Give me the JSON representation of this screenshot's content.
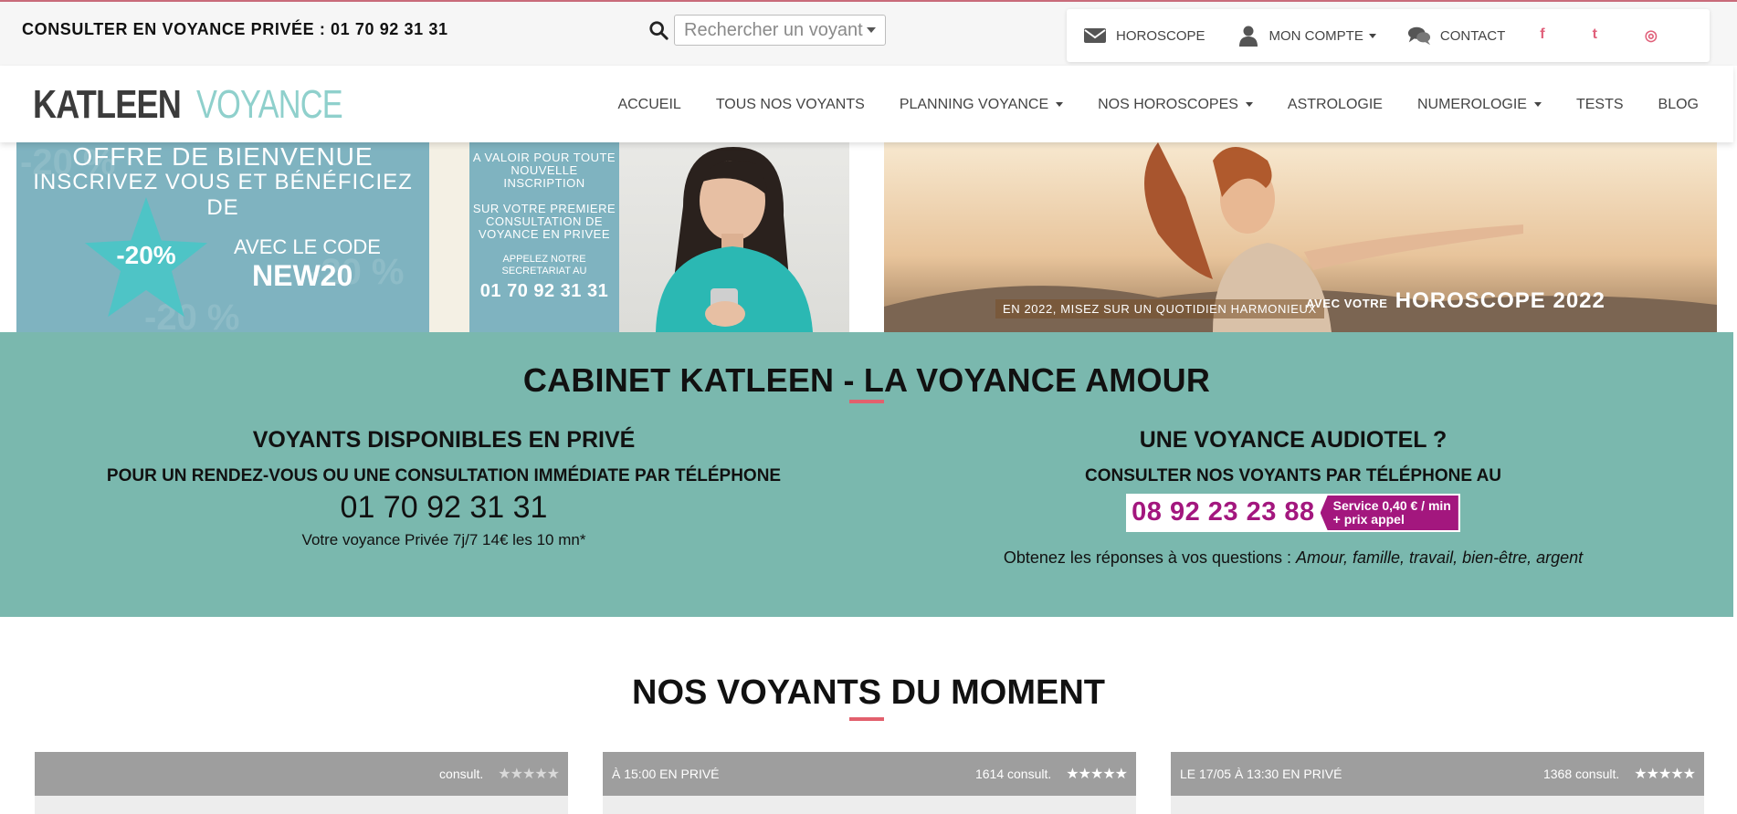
{
  "topbar": {
    "phone_line": "CONSULTER EN VOYANCE PRIVÉE : 01 70 92 31 31",
    "search_placeholder": "Rechercher un voyant",
    "menu": {
      "horoscope": "HOROSCOPE",
      "account": "MON COMPTE",
      "contact": "CONTACT"
    },
    "social": {
      "facebook": "f",
      "twitter": "t",
      "instagram": "◎"
    }
  },
  "navbar": {
    "logo_main": "KATLEEN",
    "logo_sub": "VOYANCE",
    "items": [
      "ACCUEIL",
      "TOUS NOS VOYANTS",
      "PLANNING VOYANCE",
      "NOS HOROSCOPES",
      "ASTROLOGIE",
      "NUMEROLOGIE",
      "TESTS",
      "BLOG"
    ]
  },
  "banner_left": {
    "title1": "OFFRE DE BIENVENUE",
    "title2": "INSCRIVEZ VOUS ET BÉNÉFICIEZ DE",
    "discount": "-20%",
    "code_label": "AVEC LE CODE",
    "code": "NEW20",
    "side1": "A VALOIR POUR TOUTE NOUVELLE INSCRIPTION",
    "side2": "SUR VOTRE PREMIERE CONSULTATION DE VOYANCE EN PRIVEE",
    "side3": "APPELEZ NOTRE SECRETARIAT AU",
    "side4": "01 70 92 31 31"
  },
  "banner_right": {
    "caption1": "EN 2022, MISEZ SUR UN QUOTIDIEN HARMONIEUX",
    "caption2_pre": "AVEC VOTRE",
    "caption2_big": "HOROSCOPE 2022"
  },
  "cabinet": {
    "title": "CABINET KATLEEN - LA VOYANCE AMOUR",
    "left": {
      "heading": "VOYANTS DISPONIBLES EN PRIVÉ",
      "sub": "POUR UN RENDEZ-VOUS OU UNE CONSULTATION IMMÉDIATE PAR TÉLÉPHONE",
      "phone": "01 70 92 31 31",
      "note": "Votre voyance Privée 7j/7 14€ les 10 mn*"
    },
    "right": {
      "heading": "UNE VOYANCE AUDIOTEL ?",
      "sub": "CONSULTER NOS VOYANTS PAR TÉLÉPHONE AU",
      "number": "08 92 23 23 88",
      "service1": "Service 0,40 € / min",
      "service2": "+ prix appel",
      "answers_prefix": "Obtenez les réponses à vos questions : ",
      "answers_topics": "Amour, famille, travail, bien-être, argent"
    }
  },
  "voyants": {
    "title": "NOS VOYANTS DU MOMENT",
    "cards": [
      {
        "status": "",
        "consult": "consult.",
        "stars": "★★★★★"
      },
      {
        "status": "À 15:00 EN PRIVÉ",
        "consult": "1614 consult.",
        "stars": "★★★★★"
      },
      {
        "status": "LE 17/05 À 13:30 EN PRIVÉ",
        "consult": "1368 consult.",
        "stars": "★★★★★"
      }
    ]
  },
  "colors": {
    "teal": "#7ab8ae",
    "accent": "#e2606d",
    "audiotel": "#a3177e"
  }
}
